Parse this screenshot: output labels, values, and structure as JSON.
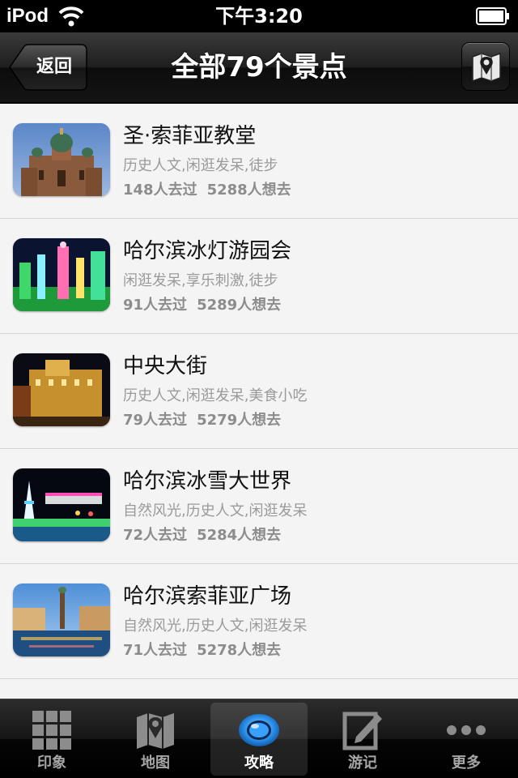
{
  "status_bar": {
    "carrier": "iPod",
    "time": "下午3:20"
  },
  "nav": {
    "back_label": "返回",
    "title": "全部79个景点",
    "map_button_icon": "map-pin-icon"
  },
  "attractions": [
    {
      "name": "圣·索菲亚教堂",
      "tags": "历史人文,闲逛发呆,徒步",
      "visited": "148人去过",
      "want": "5288人想去"
    },
    {
      "name": "哈尔滨冰灯游园会",
      "tags": "闲逛发呆,享乐刺激,徒步",
      "visited": "91人去过",
      "want": "5289人想去"
    },
    {
      "name": "中央大街",
      "tags": "历史人文,闲逛发呆,美食小吃",
      "visited": "79人去过",
      "want": "5279人想去"
    },
    {
      "name": "哈尔滨冰雪大世界",
      "tags": "自然风光,历史人文,闲逛发呆",
      "visited": "72人去过",
      "want": "5284人想去"
    },
    {
      "name": "哈尔滨索菲亚广场",
      "tags": "自然风光,历史人文,闲逛发呆",
      "visited": "71人去过",
      "want": "5278人想去"
    }
  ],
  "tabs": [
    {
      "label": "印象",
      "icon": "grid-icon",
      "selected": false
    },
    {
      "label": "地图",
      "icon": "map-icon",
      "selected": false
    },
    {
      "label": "攻略",
      "icon": "eye-icon",
      "selected": true
    },
    {
      "label": "游记",
      "icon": "edit-note-icon",
      "selected": false
    },
    {
      "label": "更多",
      "icon": "more-dots-icon",
      "selected": false
    }
  ],
  "colors": {
    "accent_blue": "#2b8fe8",
    "nav_bar": "#1e1e1e",
    "tab_selected_label": "#ffffff",
    "tab_label": "#a6a6a6"
  }
}
